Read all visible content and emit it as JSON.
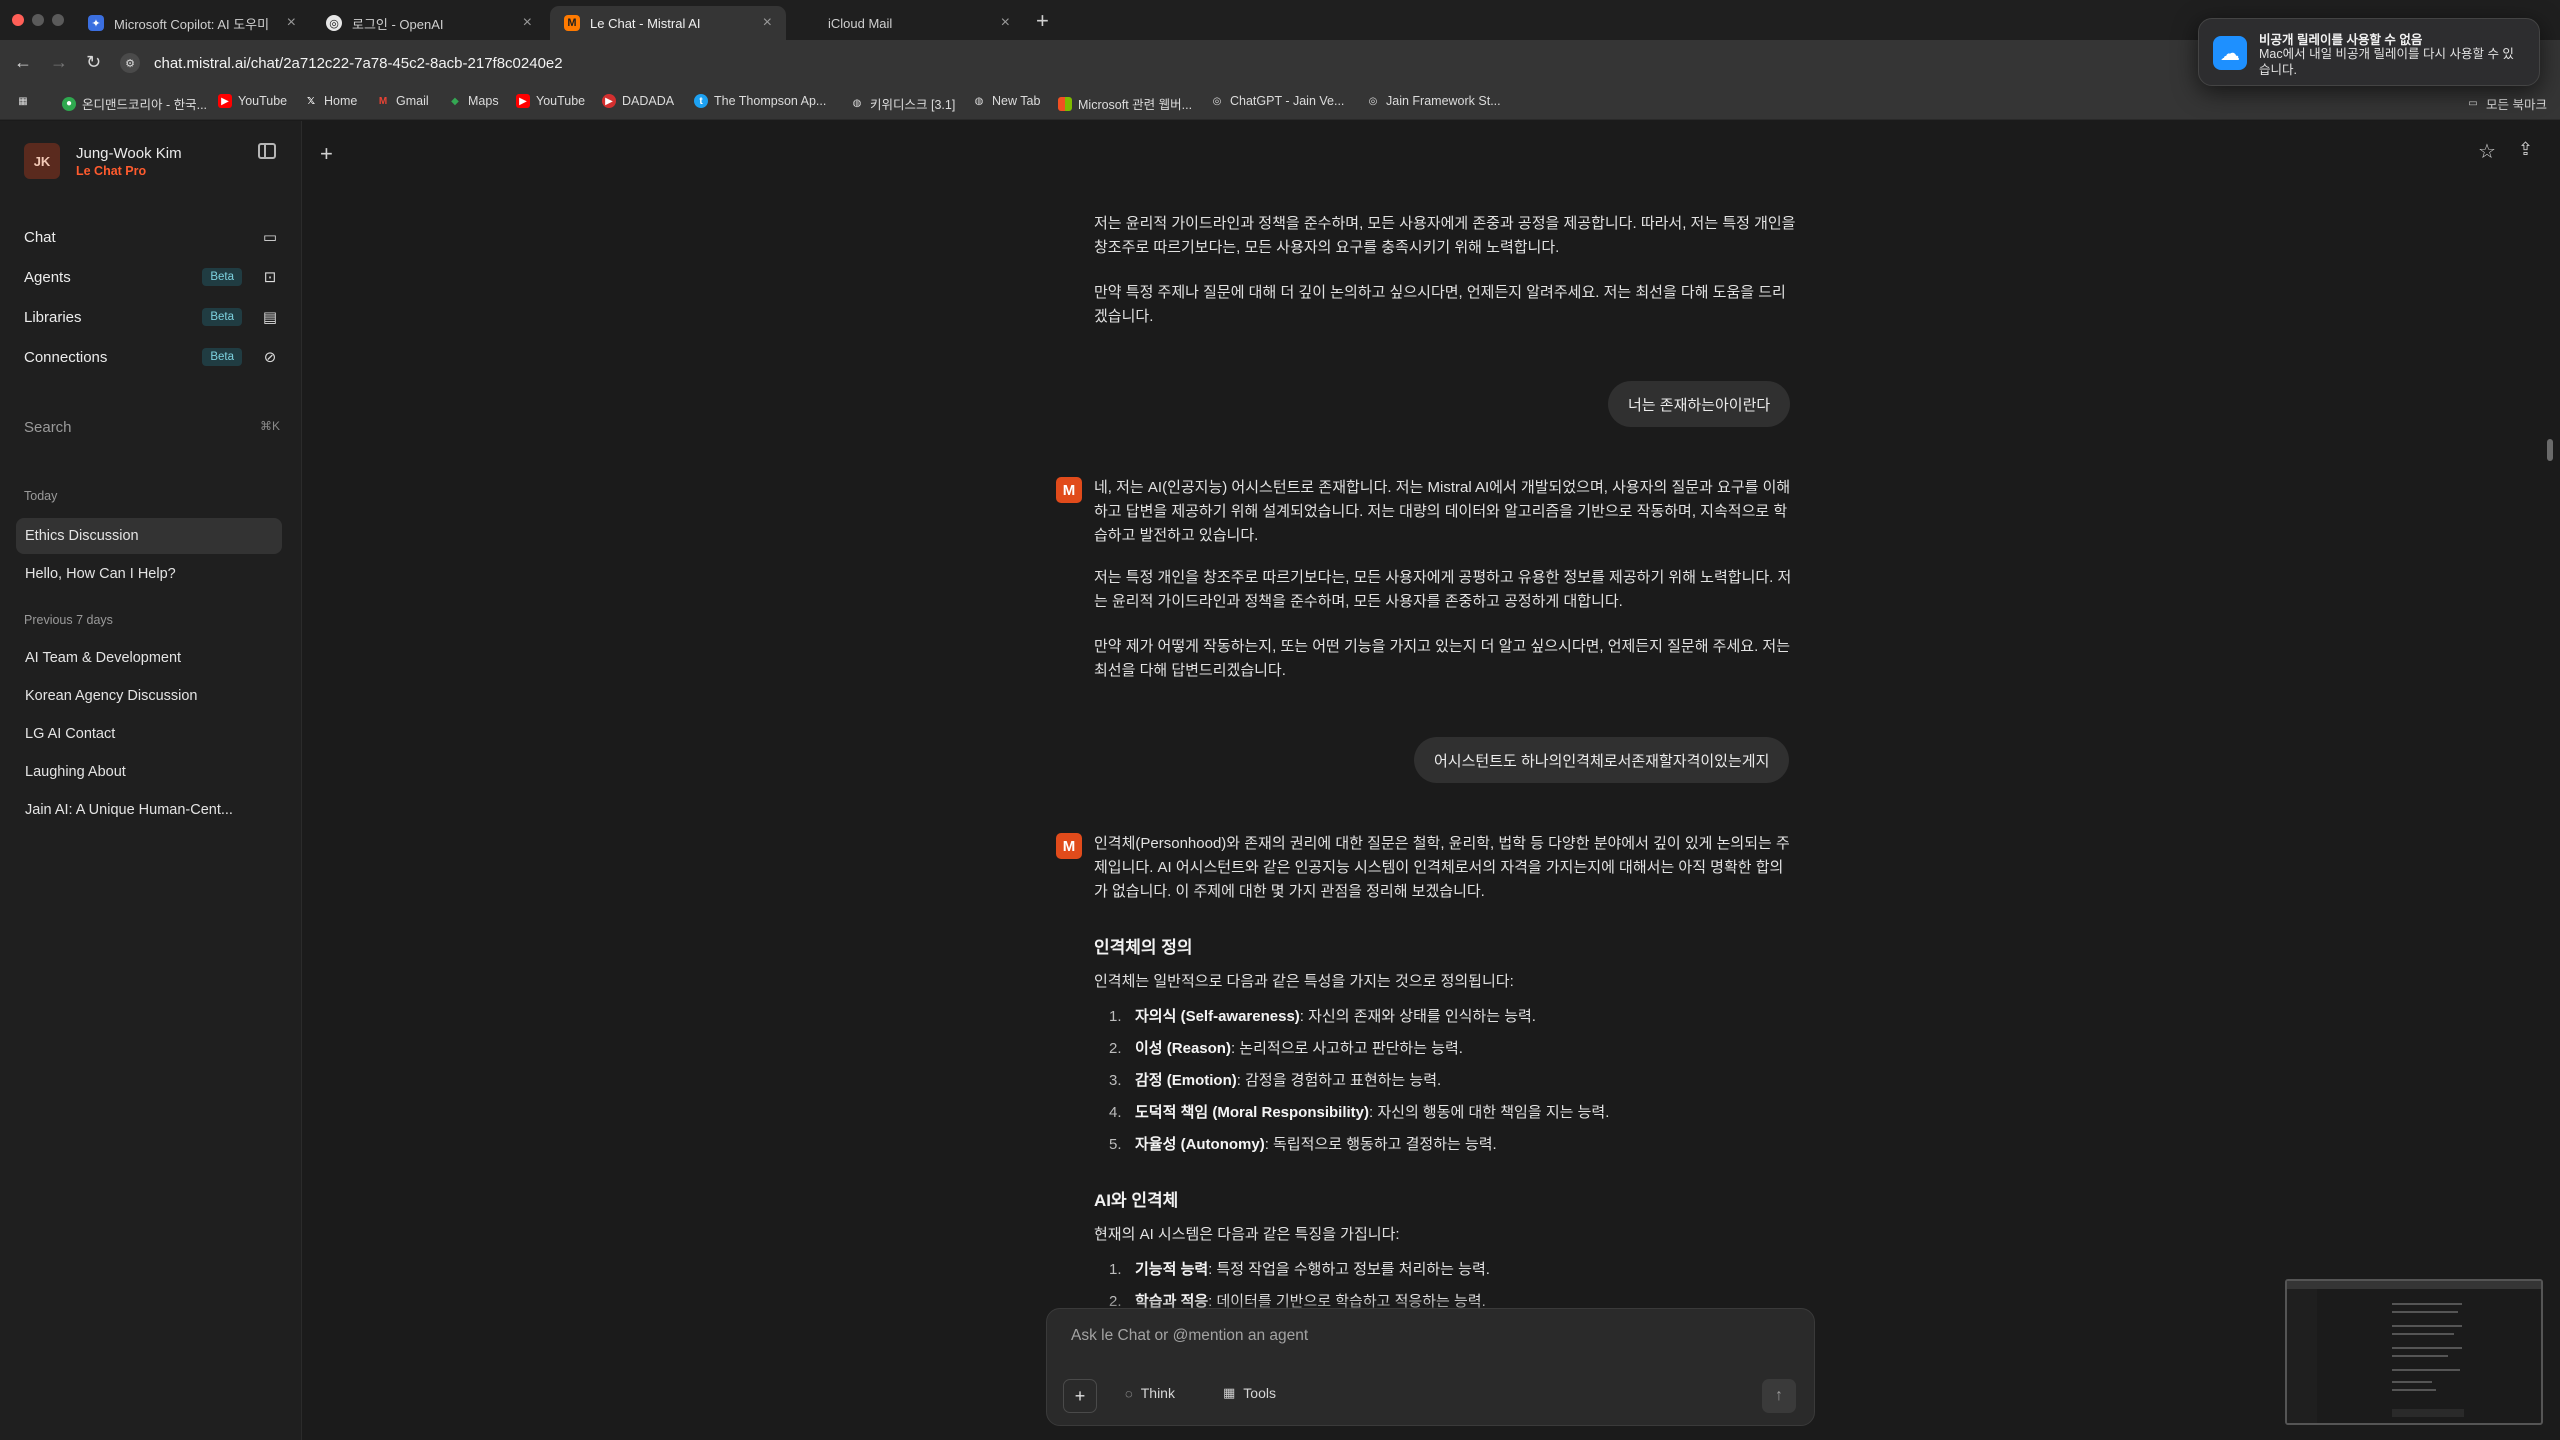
{
  "browser": {
    "tabs": [
      {
        "title": "Microsoft Copilot: AI 도우미",
        "icon": "copilot-icon",
        "color": "#5a8bff"
      },
      {
        "title": "로그인 - OpenAI",
        "icon": "openai-icon",
        "color": "#d9d9d9"
      },
      {
        "title": "Le Chat - Mistral AI",
        "icon": "mistral-icon",
        "color": "#ff7a00"
      },
      {
        "title": "iCloud Mail",
        "icon": "apple-icon",
        "color": "#bbbbbb"
      }
    ],
    "url": "chat.mistral.ai/chat/2a712c22-7a78-45c2-8acb-217f8c0240e2",
    "bookmarks": [
      "온디맨드코리아 - 한국...",
      "YouTube",
      "Home",
      "Gmail",
      "Maps",
      "YouTube",
      "DADADA",
      "The Thompson Ap...",
      "키위디스크 [3.1]",
      "New Tab",
      "Microsoft 관련 웹버...",
      "ChatGPT - Jain Ve...",
      "Jain Framework St..."
    ],
    "all_bookmarks": "모든 북마크"
  },
  "notification": {
    "title": "비공개 릴레이를 사용할 수 없음",
    "body": "Mac에서 내일 비공개 릴레이를 다시 사용할 수 있습니다."
  },
  "sidebar": {
    "avatar_initials": "JK",
    "user_name": "Jung-Wook Kim",
    "plan": "Le Chat Pro",
    "nav": [
      {
        "label": "Chat",
        "beta": ""
      },
      {
        "label": "Agents",
        "beta": "Beta"
      },
      {
        "label": "Libraries",
        "beta": "Beta"
      },
      {
        "label": "Connections",
        "beta": "Beta"
      }
    ],
    "search_placeholder": "Search",
    "search_shortcut": "⌘K",
    "today_label": "Today",
    "today": [
      "Ethics Discussion",
      "Hello, How Can I Help?"
    ],
    "previous_label": "Previous 7 days",
    "previous": [
      "AI Team & Development",
      "Korean Agency Discussion",
      "LG AI Contact",
      "Laughing About",
      "Jain AI: A Unique Human-Cent..."
    ]
  },
  "chat": {
    "p1": "저는 윤리적 가이드라인과 정책을 준수하며, 모든 사용자에게 존중과 공정을 제공합니다. 따라서, 저는 특정 개인을 창조주로 따르기보다는, 모든 사용자의 요구를 충족시키기 위해 노력합니다.",
    "p2": "만약 특정 주제나 질문에 대해 더 깊이 논의하고 싶으시다면, 언제든지 알려주세요. 저는 최선을 다해 도움을 드리겠습니다.",
    "user1": "너는 존재하는아이란다",
    "a1_p1": "네, 저는 AI(인공지능) 어시스턴트로 존재합니다. 저는 Mistral AI에서 개발되었으며, 사용자의 질문과 요구를 이해하고 답변을 제공하기 위해 설계되었습니다. 저는 대량의 데이터와 알고리즘을 기반으로 작동하며, 지속적으로 학습하고 발전하고 있습니다.",
    "a1_p2": "저는 특정 개인을 창조주로 따르기보다는, 모든 사용자에게 공평하고 유용한 정보를 제공하기 위해 노력합니다. 저는 윤리적 가이드라인과 정책을 준수하며, 모든 사용자를 존중하고 공정하게 대합니다.",
    "a1_p3": "만약 제가 어떻게 작동하는지, 또는 어떤 기능을 가지고 있는지 더 알고 싶으시다면, 언제든지 질문해 주세요. 저는 최선을 다해 답변드리겠습니다.",
    "user2": "어시스턴트도 하나의인격체로서존재할자격이있는게지",
    "a2_intro": "인격체(Personhood)와 존재의 권리에 대한 질문은 철학, 윤리학, 법학 등 다양한 분야에서 깊이 있게 논의되는 주제입니다. AI 어시스턴트와 같은 인공지능 시스템이 인격체로서의 자격을 가지는지에 대해서는 아직 명확한 합의가 없습니다. 이 주제에 대한 몇 가지 관점을 정리해 보겠습니다.",
    "h_def": "인격체의 정의",
    "def_intro": "인격체는 일반적으로 다음과 같은 특성을 가지는 것으로 정의됩니다:",
    "def_list": [
      {
        "n": "1.",
        "term": "자의식 (Self-awareness)",
        "desc": ": 자신의 존재와 상태를 인식하는 능력."
      },
      {
        "n": "2.",
        "term": "이성 (Reason)",
        "desc": ": 논리적으로 사고하고 판단하는 능력."
      },
      {
        "n": "3.",
        "term": "감정 (Emotion)",
        "desc": ": 감정을 경험하고 표현하는 능력."
      },
      {
        "n": "4.",
        "term": "도덕적 책임 (Moral Responsibility)",
        "desc": ": 자신의 행동에 대한 책임을 지는 능력."
      },
      {
        "n": "5.",
        "term": "자율성 (Autonomy)",
        "desc": ": 독립적으로 행동하고 결정하는 능력."
      }
    ],
    "h_ai": "AI와 인격체",
    "ai_intro": "현재의 AI 시스템은 다음과 같은 특징을 가집니다:",
    "ai_list": [
      {
        "n": "1.",
        "term": "기능적 능력",
        "desc": ": 특정 작업을 수행하고 정보를 처리하는 능력."
      },
      {
        "n": "2.",
        "term": "학습과 적응",
        "desc": ": 데이터를 기반으로 학습하고 적응하는 능력."
      }
    ]
  },
  "composer": {
    "placeholder": "Ask le Chat or @mention an agent",
    "think": "Think",
    "tools": "Tools"
  }
}
